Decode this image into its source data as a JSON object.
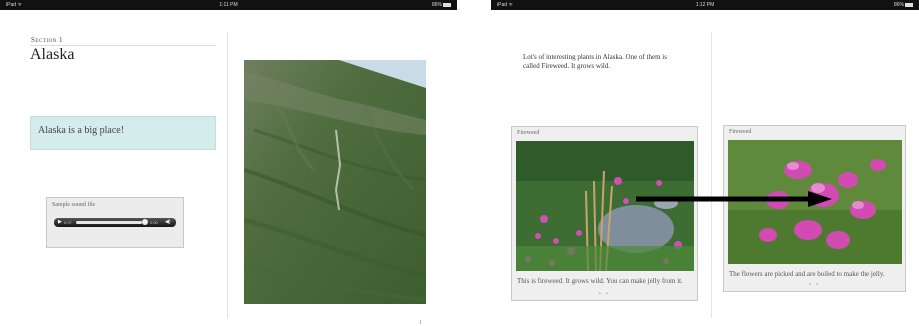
{
  "left_screen": {
    "status": {
      "carrier": "iPad ᯤ",
      "time": "1:11 PM",
      "battery": "86%"
    },
    "section_label": "Section 1",
    "title": "Alaska",
    "callout": "Alaska is a big place!",
    "audio": {
      "caption": "Sample sound file",
      "elapsed": "0:07",
      "remaining": "0:00",
      "play_icon": "play-icon",
      "volume_icon": "volume-icon"
    },
    "photo": {
      "subject": "green mountain slope",
      "colors": {
        "sky": "#c9dbe6",
        "slope": "#4a6b3a"
      }
    },
    "page_mark": "1"
  },
  "right_screen": {
    "status": {
      "carrier": "iPad ᯤ",
      "time": "1:12 PM",
      "battery": "86%"
    },
    "intro": "Lot's of interesting plants in Alaska. One of them is called Fireweed. It grows wild.",
    "gallery_left": {
      "title": "Fireweed",
      "caption": "This is fireweed. It grows wild. You can make jelly from it.",
      "dots": "• •"
    },
    "gallery_right": {
      "title": "Fireweed",
      "caption": "The flowers are picked and are boiled to make the jelly.",
      "dots": "• •"
    },
    "swipe_arrow": "right-arrow-icon"
  }
}
